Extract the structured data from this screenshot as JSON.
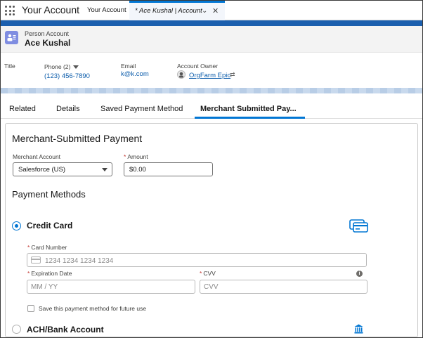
{
  "topbar": {
    "app_title": "Your Account",
    "tabs": [
      {
        "label": "Your Account"
      },
      {
        "label": "* Ace Kushal | Account"
      }
    ]
  },
  "record": {
    "type_label": "Person Account",
    "name": "Ace Kushal",
    "highlights": {
      "title_label": "Title",
      "phone_label": "Phone (2)",
      "phone_value": "(123) 456-7890",
      "email_label": "Email",
      "email_value": "k@k.com",
      "owner_label": "Account Owner",
      "owner_value": "OrgFarm Epic"
    }
  },
  "record_tabs": [
    {
      "label": "Related"
    },
    {
      "label": "Details"
    },
    {
      "label": "Saved Payment Method"
    },
    {
      "label": "Merchant Submitted Pay..."
    }
  ],
  "panel": {
    "title": "Merchant-Submitted Payment",
    "merchant_account_label": "Merchant Account",
    "merchant_account_value": "Salesforce (US)",
    "amount_label": "Amount",
    "amount_value": "$0.00",
    "payment_methods_title": "Payment Methods",
    "credit_card_label": "Credit Card",
    "card_number_label": "Card Number",
    "card_number_placeholder": "1234 1234 1234 1234",
    "expiration_label": "Expiration Date",
    "expiration_placeholder": "MM / YY",
    "cvv_label": "CVV",
    "cvv_placeholder": "CVV",
    "info_glyph": "i",
    "save_method_label": "Save this payment method for future use",
    "ach_label": "ACH/Bank Account",
    "required_marker": "*"
  },
  "icons": {
    "app_launcher": "grid-icon",
    "record": "person-account-icon",
    "credit_card": "credit-card-icon",
    "bank": "bank-icon",
    "owner_avatar": "avatar-icon",
    "owner_change": "change-owner-icon"
  },
  "colors": {
    "brand_blue": "#0176d3",
    "header_band": "#1b5fae",
    "record_icon": "#7f8de1",
    "link": "#0b5cab"
  }
}
